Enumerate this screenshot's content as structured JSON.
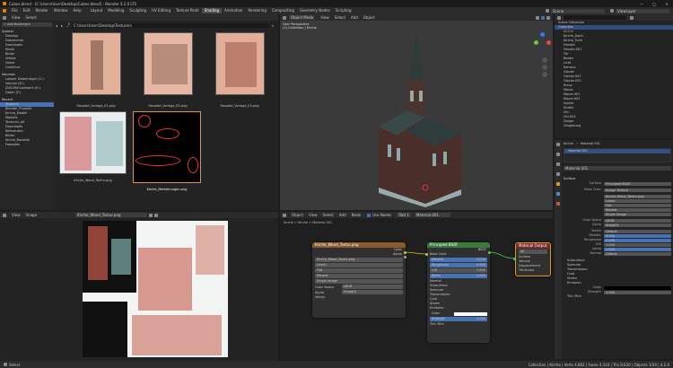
{
  "title_bar": {
    "text": "Cubes.blend - [C:\\Users\\User\\Desktop\\Cubes.blend] - Blender 4.2.0 LTS"
  },
  "menu": [
    "File",
    "Edit",
    "Render",
    "Window",
    "Help"
  ],
  "workspace_tabs": [
    "Layout",
    "Modeling",
    "Sculpting",
    "UV Editing",
    "Texture Paint",
    "Shading",
    "Animation",
    "Rendering",
    "Compositing",
    "Geometry Nodes",
    "Scripting"
  ],
  "active_tab": "Shading",
  "file_browser": {
    "path": "C:\\Users\\User\\Desktop\\Texturen\\",
    "sidebar_sections": [
      {
        "title": "Bookmarks",
        "items": []
      },
      {
        "title": "System",
        "items": [
          "Desktop",
          "Dokumente",
          "Downloads",
          "Musik",
          "Bilder",
          "Videos",
          "Home",
          "OneDrive"
        ]
      },
      {
        "title": "Volumes",
        "items": [
          "Lokaler Datenträger (C:)",
          "Volume (D:)",
          "DVD-RW-Laufwerk (E:)",
          "Daten (F:)"
        ]
      },
      {
        "title": "Recent",
        "items": [
          "Texturen",
          "Blender_Projekte",
          "Kirche_Modell",
          "Modelle",
          "Texturen_alt",
          "Downloads",
          "Referenzen",
          "Bilder",
          "Kirche_Bauteile",
          "Fassaden"
        ]
      }
    ],
    "files": [
      {
        "name": "Fassade_Vorlage_01.png"
      },
      {
        "name": "Fassade_Vorlage_02.png"
      },
      {
        "name": "Fassade_Vorlage_03.png"
      },
      {
        "name": "Kirche_Wand_Textur.png"
      },
      {
        "name": "Kirche_Markierungen.png"
      }
    ]
  },
  "viewport": {
    "mode": "Object Mode",
    "menus": [
      "View",
      "Select",
      "Add",
      "Object"
    ],
    "overlay_line1": "User Perspective",
    "overlay_line2": "(1) Collection | Kirche"
  },
  "image_editor": {
    "menus": [
      "View",
      "Image"
    ],
    "image_name": "Kirche_Wand_Textur.png",
    "tooltip": "Browse Image to be linked"
  },
  "node_editor": {
    "menus": [
      "Object",
      "View",
      "Select",
      "Add",
      "Node"
    ],
    "use_nodes": "Use Nodes",
    "slot": "Slot 1",
    "material": "Material.001",
    "breadcrumb": "Kirche  >  Kirche  >  Material.001",
    "image_node": {
      "title": "Kirche_Wand_Textur.png",
      "outputs": [
        "Color",
        "Alpha"
      ],
      "fields": [
        "Kirche_Wand_Textur.png",
        "Linear",
        "Flat",
        "Repeat",
        "Single Image",
        "sRGB",
        "Straight"
      ],
      "labels": [
        "",
        "",
        "",
        "",
        "",
        "Color Space",
        "Alpha"
      ],
      "vector": "Vector"
    },
    "bsdf_node": {
      "title": "Principled BSDF",
      "output": "BSDF",
      "rows": [
        "Base Color",
        "Metallic",
        "Roughness",
        "IOR",
        "Alpha",
        "Normal",
        "Subsurface",
        "Specular",
        "Transmission",
        "Coat",
        "Sheen",
        "Emission",
        "Color",
        "Strength",
        "Thin Film"
      ],
      "values": [
        "",
        "0.000",
        "0.500",
        "1.500",
        "1.000",
        "",
        "",
        "",
        "",
        "",
        "",
        "",
        "",
        "1.000",
        ""
      ]
    },
    "output_node": {
      "title": "Material Output",
      "target": "All",
      "inputs": [
        "Surface",
        "Volume",
        "Displacement",
        "Thickness"
      ]
    }
  },
  "outliner": {
    "header": "Scene",
    "view_layer": "ViewLayer",
    "items": [
      "Scene Collection",
      "Collection",
      "Kirche",
      "Kirche_Dach",
      "Kirche_Turm",
      "Fenster",
      "Fenster.001",
      "Tür",
      "Boden",
      "Licht",
      "Kamera",
      "Glocke",
      "Glocke.001",
      "Glocke.002",
      "Kreuz",
      "Mauer",
      "Mauer.001",
      "Mauer.002",
      "Sockel",
      "Stufen",
      "Uhr",
      "Uhr.001",
      "Zeiger",
      "Umgebung"
    ]
  },
  "properties": {
    "object": "Kirche",
    "material": "Material.001",
    "slot_item": "Material.001",
    "section_surface": "Surface",
    "surface": "Principled BSDF",
    "base_color_label": "Base Color",
    "base_color_image": "Kirche_Wand_Textur.png",
    "rows": [
      {
        "k": "",
        "v": "Linear"
      },
      {
        "k": "",
        "v": "Flat"
      },
      {
        "k": "",
        "v": "Repeat"
      },
      {
        "k": "",
        "v": "Single Image"
      },
      {
        "k": "Color Space",
        "v": "sRGB"
      },
      {
        "k": "Alpha",
        "v": "Straight"
      },
      {
        "k": "Vector",
        "v": "Default"
      },
      {
        "k": "Metallic",
        "v": "0.000"
      },
      {
        "k": "Roughness",
        "v": "0.500"
      },
      {
        "k": "IOR",
        "v": "1.500"
      },
      {
        "k": "Alpha",
        "v": "1.000"
      },
      {
        "k": "Normal",
        "v": "Default"
      }
    ],
    "subpanels": [
      "Subsurface",
      "Specular",
      "Transmission",
      "Coat",
      "Sheen",
      "Emission"
    ],
    "emission_color": "Color",
    "emission_strength": {
      "k": "Strength",
      "v": "1.000"
    },
    "thin_film": "Thin Film"
  },
  "status_bar": {
    "left": "Select",
    "right": "Collection | Kirche | Verts 4,862 | Faces 4,310 | Tris 8,620 | Objects 1/24 | 4.2.0"
  },
  "colors": {
    "accent": "#e49528",
    "blue": "#4772b3",
    "image_header": "#8a5a2b",
    "bsdf_header": "#3b7a3b",
    "output_header": "#7a2b2b"
  }
}
